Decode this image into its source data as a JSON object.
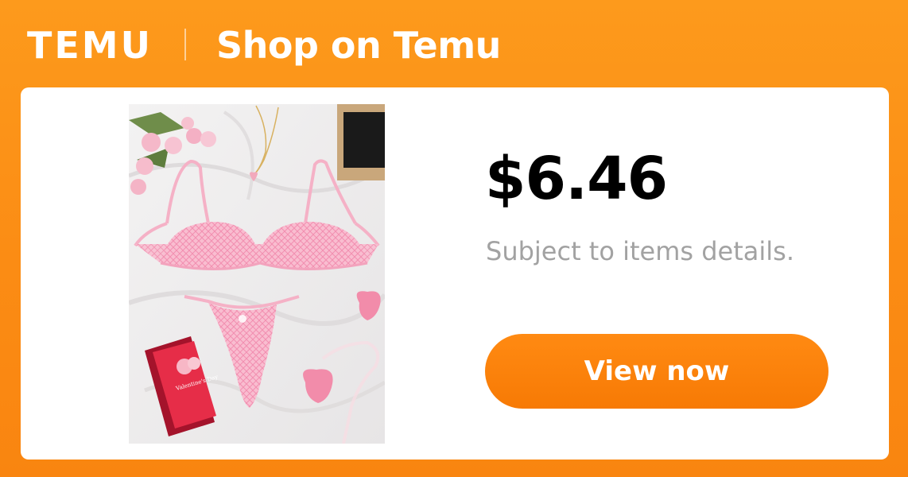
{
  "header": {
    "logo_text": "TEMU",
    "title": "Shop on Temu"
  },
  "product": {
    "price": "$6.46",
    "note": "Subject to items details.",
    "image_icon": "lingerie-set-photo",
    "card_text": "Valentine's Day"
  },
  "cta": {
    "label": "View now"
  },
  "colors": {
    "brand_orange": "#fb8c14",
    "button_orange": "#f77a05",
    "price_text": "#000000",
    "note_text": "#a2a2a2",
    "lingerie_pink": "#f7b3c8"
  }
}
